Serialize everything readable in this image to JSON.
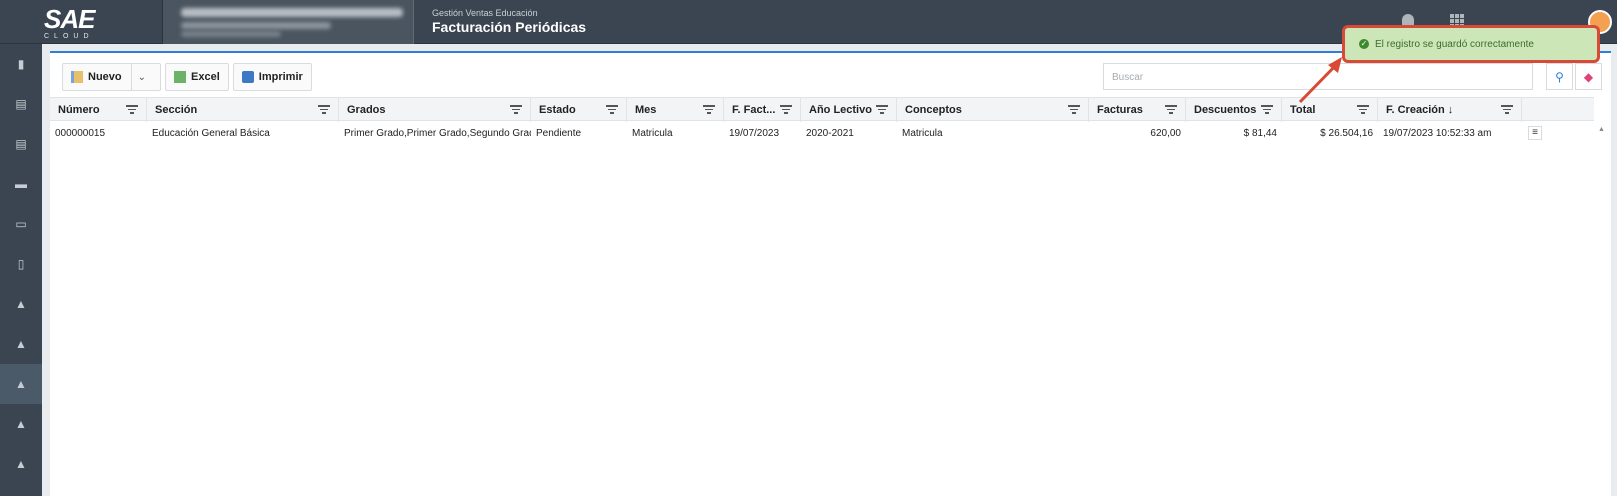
{
  "header": {
    "logo_text": "SAE",
    "logo_sub": "CLOUD",
    "module_sub": "Gestión Ventas Educación",
    "module_title": "Facturación Periódicas"
  },
  "toolbar": {
    "new_label": "Nuevo",
    "excel_label": "Excel",
    "print_label": "Imprimir"
  },
  "search": {
    "placeholder": "Buscar"
  },
  "table": {
    "columns": [
      "Número",
      "Sección",
      "Grados",
      "Estado",
      "Mes",
      "F. Fact...",
      "Año Lectivo",
      "Conceptos",
      "Facturas",
      "Descuentos",
      "Total",
      "F. Creación ↓"
    ],
    "rows": [
      [
        "000000015",
        "Educación General Básica",
        "Primer Grado,Primer Grado,Segundo Grado,...",
        "Pendiente",
        "Matricula",
        "19/07/2023",
        "2020-2021",
        "Matricula",
        "620,00",
        "$ 81,44",
        "$ 26.504,16",
        "19/07/2023 10:52:33 am"
      ]
    ]
  },
  "toast": {
    "message": "El registro se guardó correctamente"
  },
  "colors": {
    "accent": "#2f7fd6",
    "sidebar": "#3a4551",
    "toast_bg": "#cde6b8",
    "toast_border": "#d84a35"
  },
  "sidebar": {
    "icons": [
      "book-icon",
      "list-icon",
      "list-icon",
      "briefcase-icon",
      "id-card-icon",
      "document-icon",
      "graduation-cap-icon",
      "graduation-cap-icon",
      "graduation-cap-icon",
      "graduation-cap-icon",
      "graduation-cap-icon"
    ],
    "active_index": 8
  }
}
